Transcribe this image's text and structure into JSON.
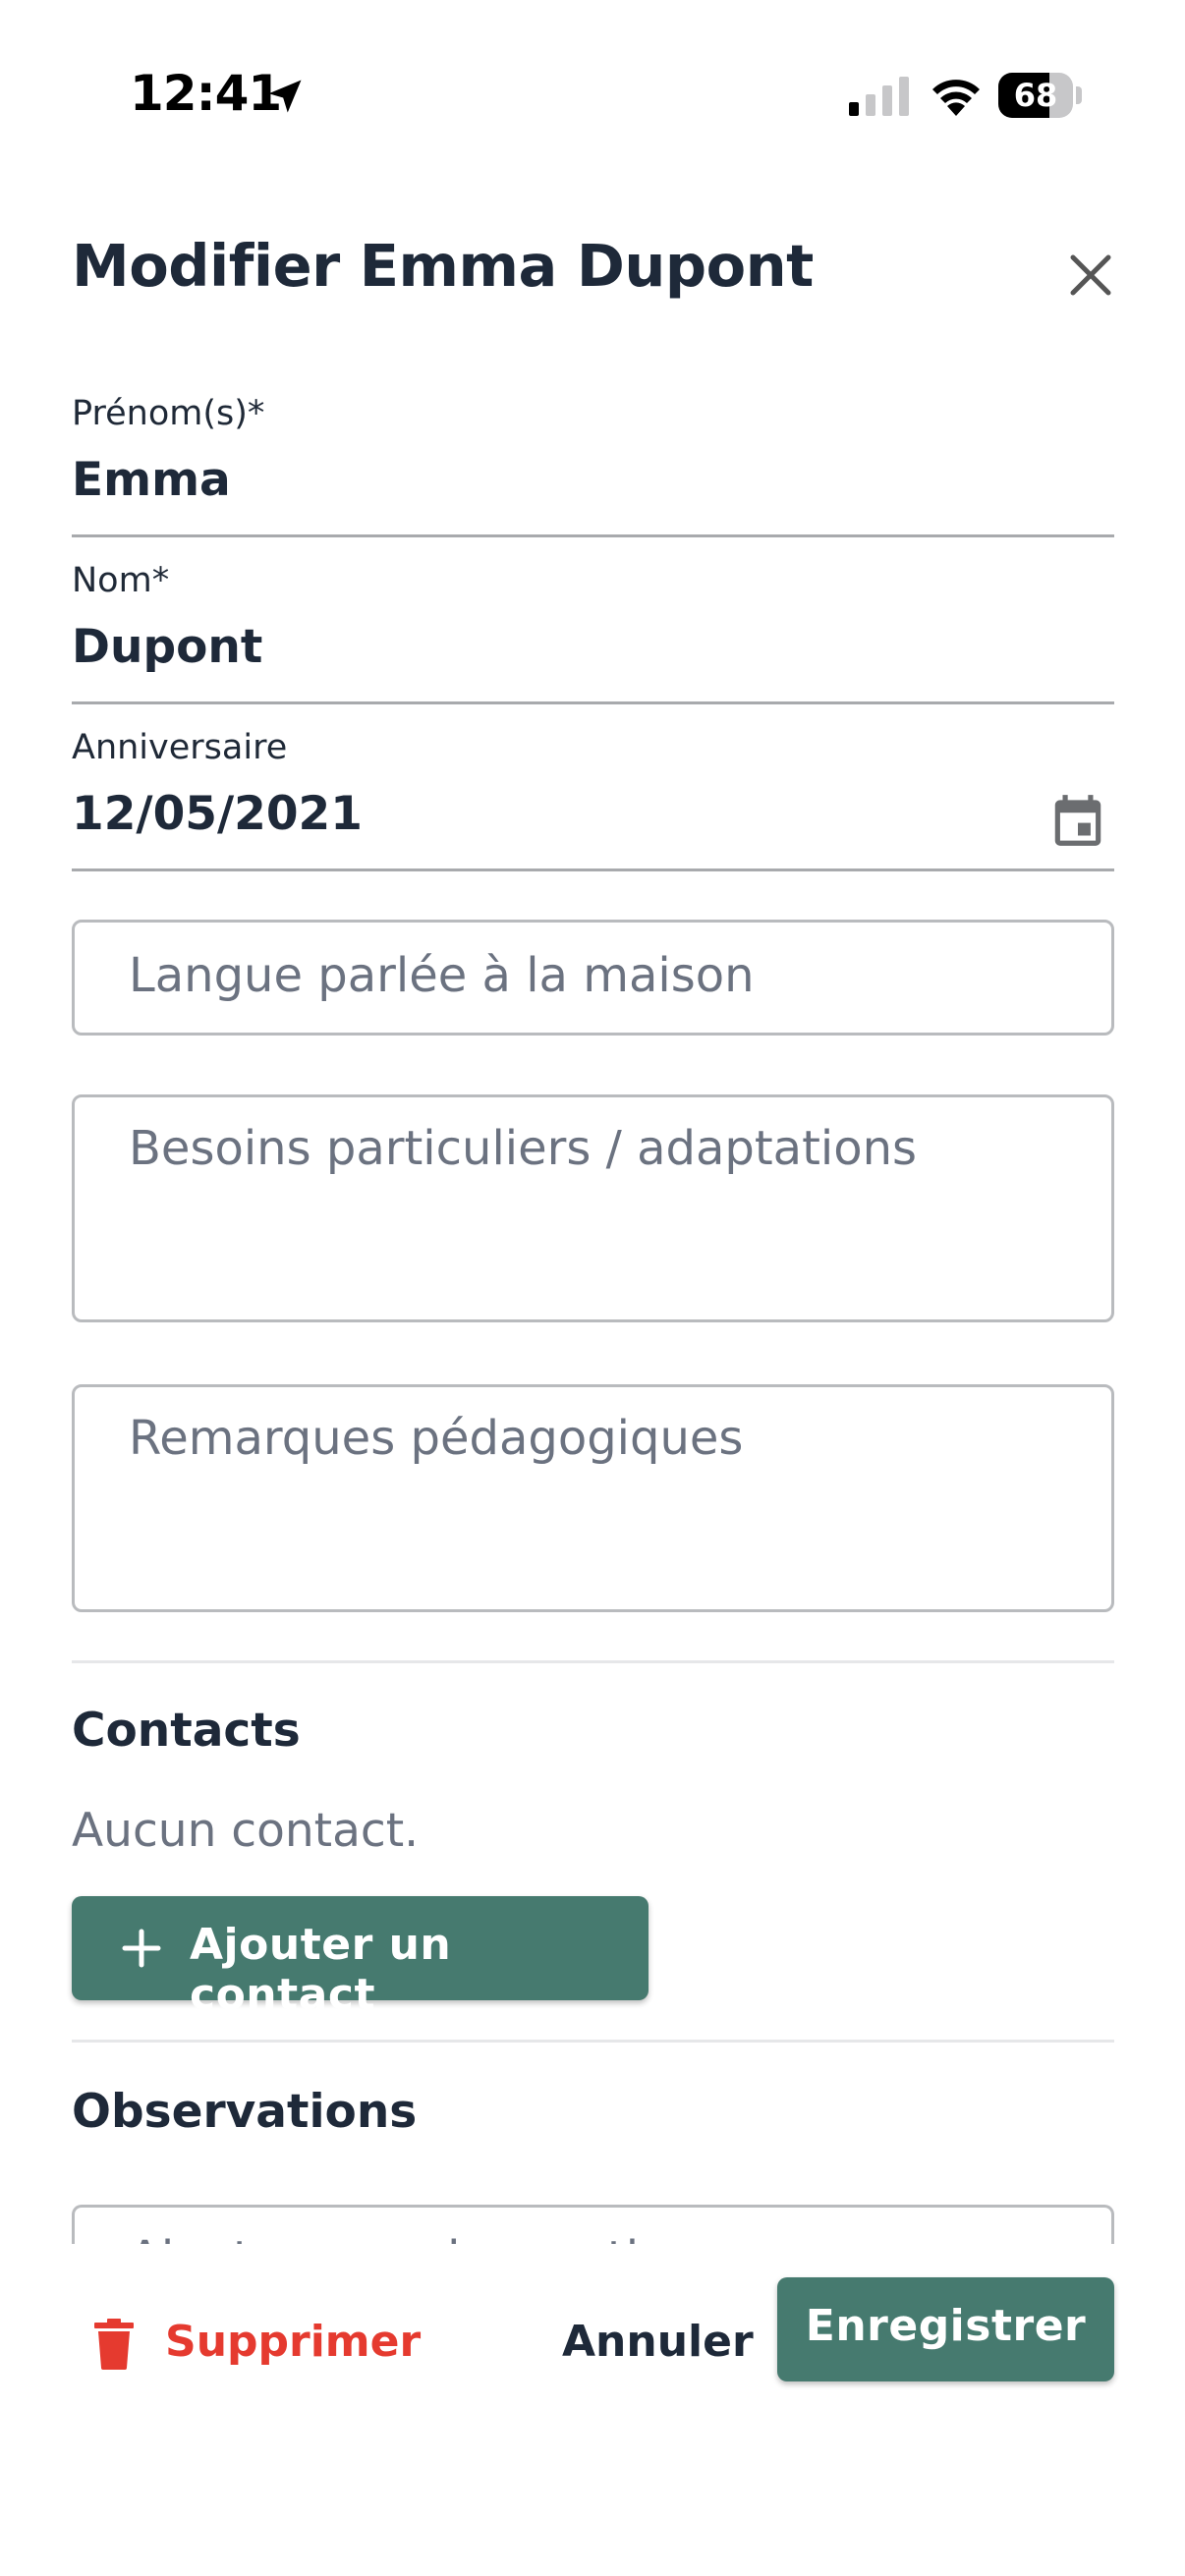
{
  "status_bar": {
    "time": "12:41",
    "battery_level": "68",
    "battery_fraction": 0.68,
    "icons": [
      "location-arrow-icon",
      "signal-icon",
      "wifi-icon",
      "battery-icon"
    ]
  },
  "dialog": {
    "title": "Modifier Emma Dupont",
    "close_icon": "close-icon"
  },
  "fields": {
    "first_name": {
      "label": "Prénom(s)*",
      "value": "Emma"
    },
    "last_name": {
      "label": "Nom*",
      "value": "Dupont"
    },
    "birthday": {
      "label": "Anniversaire",
      "value": "12/05/2021",
      "icon": "calendar-icon"
    },
    "language": {
      "placeholder": "Langue parlée à la maison"
    },
    "special_needs": {
      "placeholder": "Besoins particuliers / adaptations"
    },
    "pedagogical_notes": {
      "placeholder": "Remarques pédagogiques"
    }
  },
  "contacts": {
    "title": "Contacts",
    "empty_text": "Aucun contact.",
    "add_button_label": "Ajouter un contact"
  },
  "observations": {
    "title": "Observations",
    "input_placeholder_partial": "Ajouter une observation"
  },
  "footer": {
    "delete_label": "Supprimer",
    "cancel_label": "Annuler",
    "save_label": "Enregistrer"
  },
  "colors": {
    "primary": "#467a6f",
    "danger": "#e53a2f",
    "text_dark": "#1e2939",
    "text_muted": "#6b7280"
  }
}
